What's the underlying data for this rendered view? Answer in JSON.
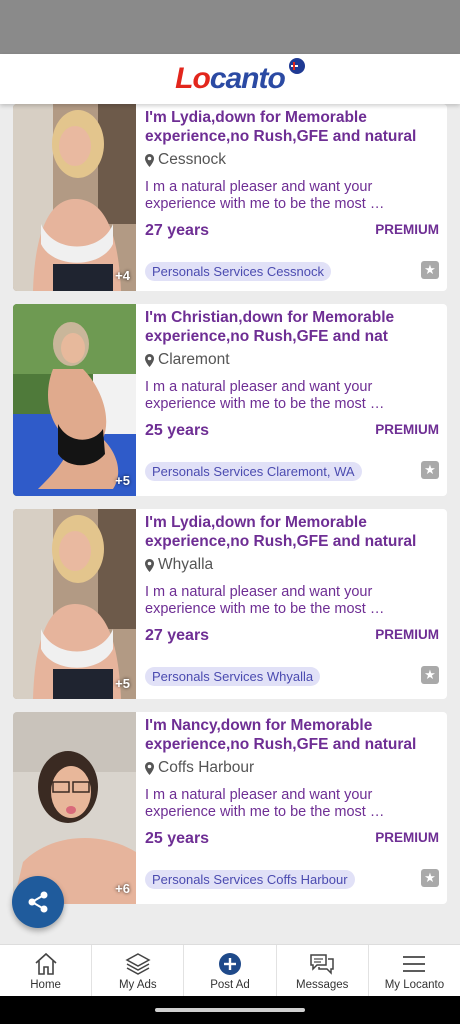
{
  "header": {
    "logo_part1": "Lo",
    "logo_part2": "canto",
    "flag": "australia-flag-icon"
  },
  "listings": [
    {
      "title": "I'm Lydia,down for Memorable experience,no Rush,GFE and natural",
      "location": "Cessnock",
      "description": "I m a natural pleaser and want your experience with me to be the most …",
      "age": "27 years",
      "badge": "PREMIUM",
      "tag": "Personals Services Cessnock",
      "photo_count": "+4"
    },
    {
      "title": "I'm Christian,down for Memorable experience,no Rush,GFE and nat",
      "location": "Claremont",
      "description": "I m a natural pleaser and want your experience with me to be the most …",
      "age": "25 years",
      "badge": "PREMIUM",
      "tag": "Personals Services Claremont, WA",
      "photo_count": "+5"
    },
    {
      "title": "I'm Lydia,down for Memorable experience,no Rush,GFE and natural",
      "location": "Whyalla",
      "description": "I m a natural pleaser and want your experience with me to be the most …",
      "age": "27 years",
      "badge": "PREMIUM",
      "tag": "Personals Services Whyalla",
      "photo_count": "+5"
    },
    {
      "title": "I'm Nancy,down for Memorable experience,no Rush,GFE and natural",
      "location": "Coffs Harbour",
      "description": "I m a natural pleaser and want your experience with me to be the most …",
      "age": "25 years",
      "badge": "PREMIUM",
      "tag": "Personals Services Coffs Harbour",
      "photo_count": "+6"
    }
  ],
  "share_button": "share-icon",
  "bottom_nav": {
    "items": [
      {
        "label": "Home",
        "icon": "home-icon"
      },
      {
        "label": "My Ads",
        "icon": "layers-icon"
      },
      {
        "label": "Post Ad",
        "icon": "plus-circle-icon"
      },
      {
        "label": "Messages",
        "icon": "chat-icon"
      },
      {
        "label": "My Locanto",
        "icon": "menu-icon"
      }
    ]
  },
  "colors": {
    "title_purple": "#6e2e94",
    "tag_bg": "#e1e1f7",
    "fab_blue": "#1f5b9c",
    "logo_blue": "#2b4aa3",
    "logo_red": "#e2261c"
  }
}
